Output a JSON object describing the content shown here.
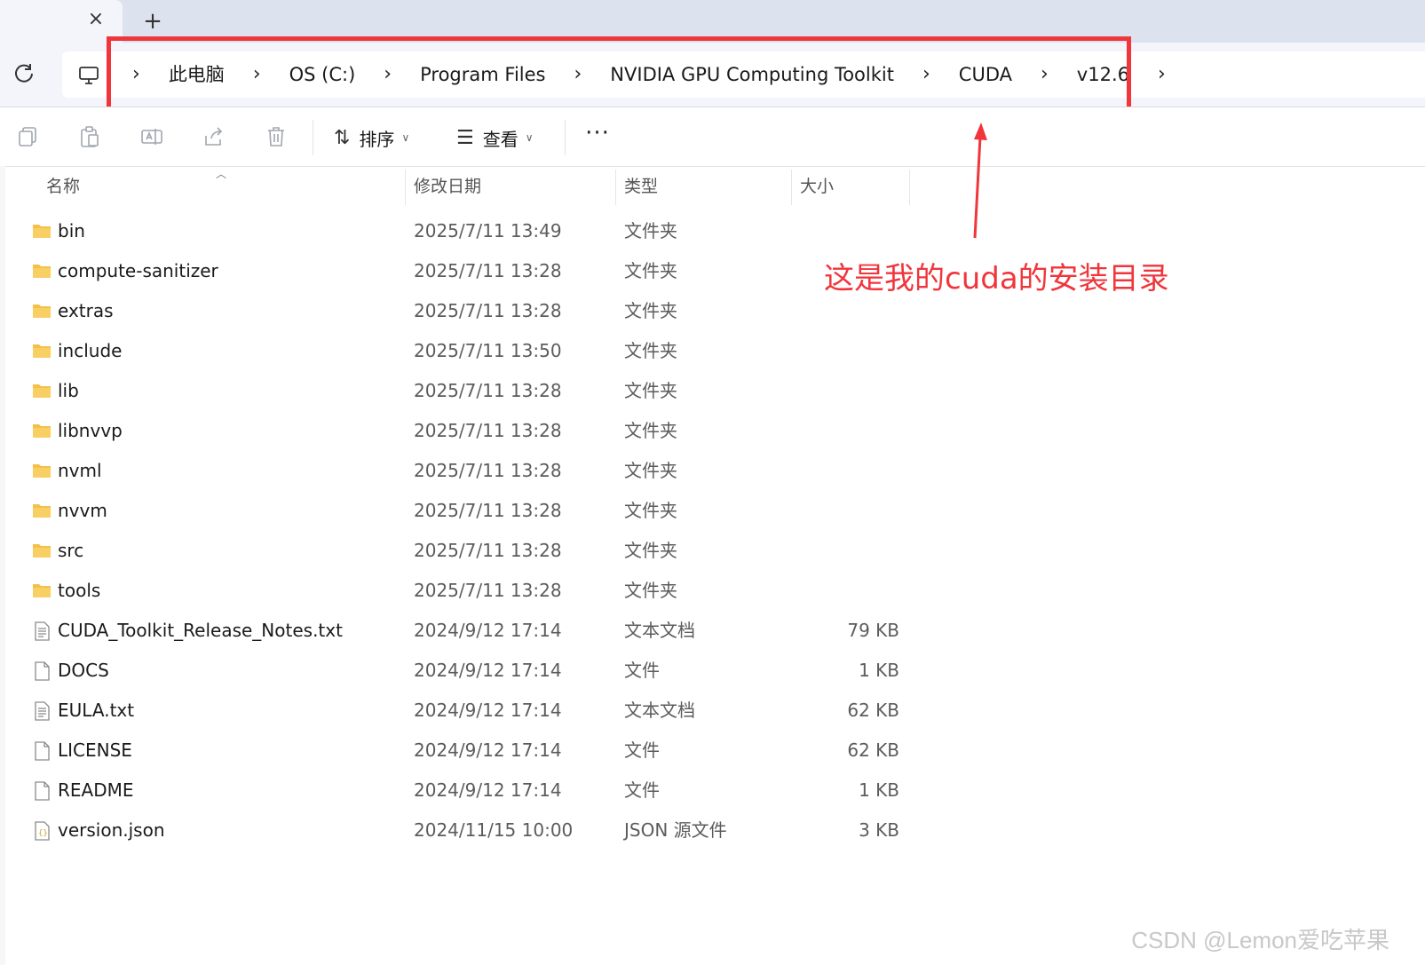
{
  "tabbar": {
    "close_glyph": "×",
    "new_tab_glyph": "+"
  },
  "toolbar": {
    "refresh_icon": "refresh-icon"
  },
  "breadcrumb": {
    "items": [
      "此电脑",
      "OS (C:)",
      "Program Files",
      "NVIDIA GPU Computing Toolkit",
      "CUDA",
      "v12.6"
    ],
    "separator": "›"
  },
  "commands": {
    "sort_label": "排序",
    "view_label": "查看",
    "more_label": "···"
  },
  "columns": {
    "name": "名称",
    "modified": "修改日期",
    "type": "类型",
    "size": "大小"
  },
  "files": [
    {
      "name": "bin",
      "date": "2025/7/11 13:49",
      "type": "文件夹",
      "size": "",
      "kind": "folder"
    },
    {
      "name": "compute-sanitizer",
      "date": "2025/7/11 13:28",
      "type": "文件夹",
      "size": "",
      "kind": "folder"
    },
    {
      "name": "extras",
      "date": "2025/7/11 13:28",
      "type": "文件夹",
      "size": "",
      "kind": "folder"
    },
    {
      "name": "include",
      "date": "2025/7/11 13:50",
      "type": "文件夹",
      "size": "",
      "kind": "folder"
    },
    {
      "name": "lib",
      "date": "2025/7/11 13:28",
      "type": "文件夹",
      "size": "",
      "kind": "folder"
    },
    {
      "name": "libnvvp",
      "date": "2025/7/11 13:28",
      "type": "文件夹",
      "size": "",
      "kind": "folder"
    },
    {
      "name": "nvml",
      "date": "2025/7/11 13:28",
      "type": "文件夹",
      "size": "",
      "kind": "folder"
    },
    {
      "name": "nvvm",
      "date": "2025/7/11 13:28",
      "type": "文件夹",
      "size": "",
      "kind": "folder"
    },
    {
      "name": "src",
      "date": "2025/7/11 13:28",
      "type": "文件夹",
      "size": "",
      "kind": "folder"
    },
    {
      "name": "tools",
      "date": "2025/7/11 13:28",
      "type": "文件夹",
      "size": "",
      "kind": "folder"
    },
    {
      "name": "CUDA_Toolkit_Release_Notes.txt",
      "date": "2024/9/12 17:14",
      "type": "文本文档",
      "size": "79 KB",
      "kind": "text"
    },
    {
      "name": "DOCS",
      "date": "2024/9/12 17:14",
      "type": "文件",
      "size": "1 KB",
      "kind": "file"
    },
    {
      "name": "EULA.txt",
      "date": "2024/9/12 17:14",
      "type": "文本文档",
      "size": "62 KB",
      "kind": "text"
    },
    {
      "name": "LICENSE",
      "date": "2024/9/12 17:14",
      "type": "文件",
      "size": "62 KB",
      "kind": "file"
    },
    {
      "name": "README",
      "date": "2024/9/12 17:14",
      "type": "文件",
      "size": "1 KB",
      "kind": "file"
    },
    {
      "name": "version.json",
      "date": "2024/11/15 10:00",
      "type": "JSON 源文件",
      "size": "3 KB",
      "kind": "json"
    }
  ],
  "annotation": {
    "text": "这是我的cuda的安装目录",
    "color": "#f0353b"
  },
  "watermark": "CSDN @Lemon爱吃苹果",
  "colors": {
    "folder": "#f5c04a",
    "accent_red": "#f0353b"
  }
}
